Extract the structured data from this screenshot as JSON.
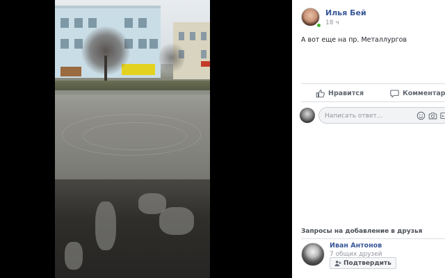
{
  "post": {
    "author_name": "Илья Бей",
    "time": "18 ч",
    "text": "А вот еще на пр. Металлургов",
    "author_online": true
  },
  "actions": {
    "like_label": "Нравится",
    "comment_label": "Комментарий"
  },
  "reply": {
    "placeholder": "Написать ответ..."
  },
  "friend_requests": {
    "title": "Запросы на добавление в друзья",
    "items": [
      {
        "name": "Иван Антонов",
        "mutual": "7 общих друзей",
        "confirm_label": "Подтвердить"
      }
    ]
  },
  "icons": {
    "like": "thumbs-up-icon",
    "comment": "speech-bubble-icon",
    "emoji": "smiley-icon",
    "camera": "camera-icon",
    "gif": "gif-icon",
    "add_friend": "add-friend-icon"
  },
  "colors": {
    "link": "#385898",
    "online": "#42b72a",
    "muted": "#90949c"
  }
}
